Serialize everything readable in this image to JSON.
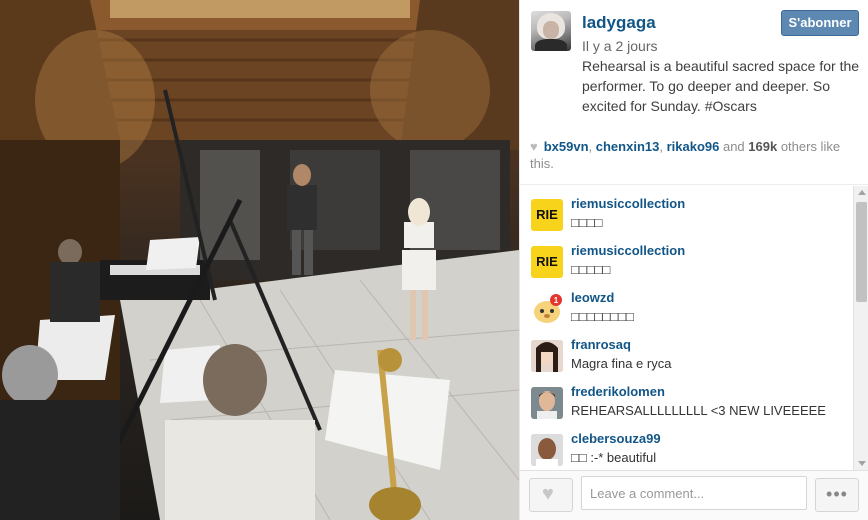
{
  "post": {
    "username": "ladygaga",
    "time_ago": "Il y a 2 jours",
    "caption": "Rehearsal is a beautiful sacred space for the performer. To go deeper and deeper. So excited for Sunday. #Oscars",
    "follow_label": "S'abonner"
  },
  "likes": {
    "users": [
      "bx59vn",
      "chenxin13",
      "rikako96"
    ],
    "sep1": ", ",
    "sep2": ", ",
    "and_text": " and ",
    "count": "169k",
    "others_text": " others like this."
  },
  "comments": [
    {
      "user": "riemusiccollection",
      "text": "□□□□",
      "avatar": "RIE"
    },
    {
      "user": "riemusiccollection",
      "text": "□□□□□",
      "avatar": "RIE"
    },
    {
      "user": "leowzd",
      "text": "□□□□□□□□",
      "avatar": ""
    },
    {
      "user": "franrosaq",
      "text": "Magra fina e ryca",
      "avatar": ""
    },
    {
      "user": "frederikolomen",
      "text": "REHEARSALLLLLLLLL <3 NEW LIVEEEEE",
      "avatar": ""
    },
    {
      "user": "clebersouza99",
      "text": "□□ :-* beautiful",
      "avatar": ""
    }
  ],
  "footer": {
    "comment_placeholder": "Leave a comment...",
    "more_label": "•••"
  },
  "colors": {
    "username_blue": "#125688",
    "follow_button": "#5c88b2",
    "rie_yellow": "#f7d31c"
  },
  "icons": {
    "like_heart": "heart-icon",
    "options": "ellipsis-icon",
    "notification": "badge-icon"
  }
}
